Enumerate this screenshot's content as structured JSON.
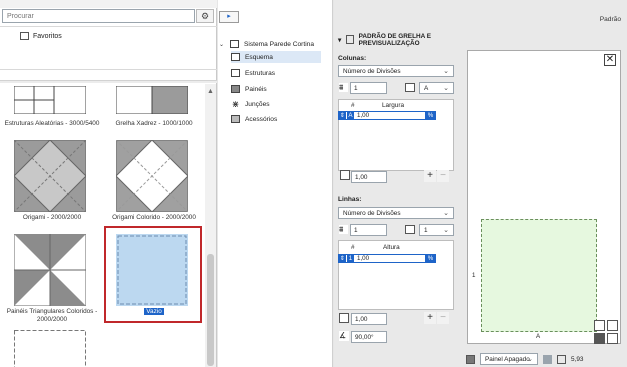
{
  "search": {
    "placeholder": "Procurar"
  },
  "favorites": {
    "label": "Favoritos"
  },
  "gallery": [
    {
      "label": "Estruturas Aleatórias - 3000/5400"
    },
    {
      "label": "Grelha Xadrez - 1000/1000"
    },
    {
      "label": "Origami - 2000/2000"
    },
    {
      "label": "Origami Colorido - 2000/2000"
    },
    {
      "label": "Painéis Triangulares Coloridos - 2000/2000"
    },
    {
      "label": "Vazio"
    }
  ],
  "tree": {
    "root": "Sistema Parede Cortina",
    "items": [
      {
        "label": "Esquema"
      },
      {
        "label": "Estruturas"
      },
      {
        "label": "Painéis"
      },
      {
        "label": "Junções"
      },
      {
        "label": "Acessórios"
      }
    ]
  },
  "header": {
    "preset": "Padrão"
  },
  "section": {
    "title": "PADRÃO DE GRELHA E PREVISUALIZAÇÃO"
  },
  "columns": {
    "label": "Colunas:",
    "mode": "Número de Divisões",
    "count": "1",
    "letter": "A",
    "col_hash": "#",
    "col_width": "Largura",
    "row_letter": "A",
    "row_value": "1,00",
    "total": "1,00"
  },
  "rows": {
    "label": "Linhas:",
    "mode": "Número de Divisões",
    "count": "1",
    "letter": "1",
    "col_hash": "#",
    "col_height": "Altura",
    "row_letter": "1",
    "row_value": "1,00",
    "total": "1,00",
    "angle": "90,00°"
  },
  "preview": {
    "axis_a": "A",
    "axis_1": "1"
  },
  "bottom": {
    "panel_mode": "Painel Apagado",
    "value": "5,93"
  }
}
